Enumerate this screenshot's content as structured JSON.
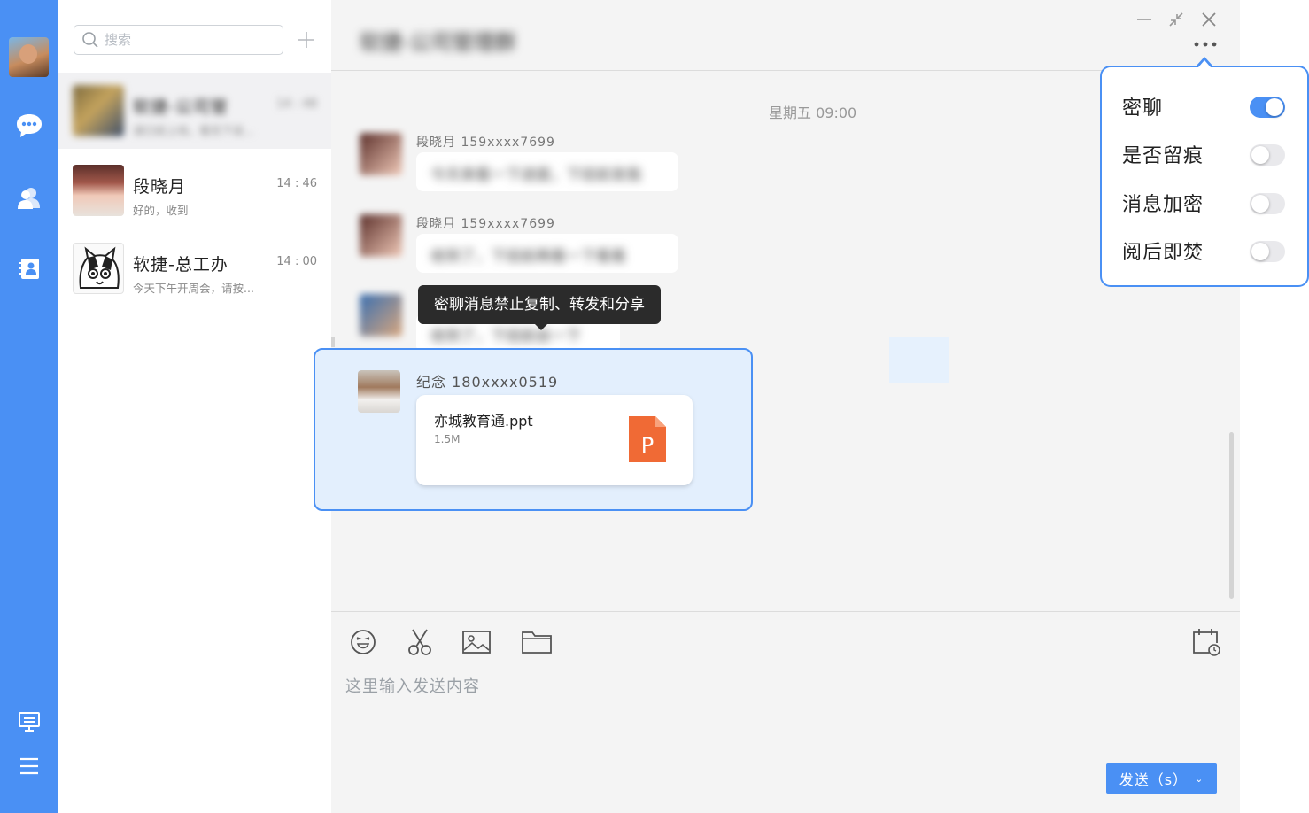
{
  "search": {
    "placeholder": "搜索"
  },
  "conversations": [
    {
      "name": "软捷-公司管",
      "time": "14 : 48",
      "preview": "请已经上线，看完下说...",
      "blurred": true
    },
    {
      "name": "段晓月",
      "time": "14 : 46",
      "preview": "好的，收到"
    },
    {
      "name": "软捷-总工办",
      "time": "14 : 00",
      "preview": "今天下午开周会，请按..."
    }
  ],
  "chat": {
    "title": "软捷-公司管理群",
    "date_stamp": "星期五 09:00",
    "messages": [
      {
        "sender": "段晓月 159xxxx7699",
        "text": "今天来看一下进度，下班前发我"
      },
      {
        "sender": "段晓月 159xxxx7699",
        "text": "收到了，下班前再看一下看看"
      },
      {
        "sender": "",
        "text": "收到了，下班前会一下"
      }
    ],
    "tooltip": "密聊消息禁止复制、转发和分享",
    "file_message": {
      "sender": "纪念  180xxxx0519",
      "file_name": "亦城教育通.ppt",
      "file_size": "1.5M",
      "file_icon_letter": "P"
    }
  },
  "composer": {
    "placeholder": "这里输入发送内容",
    "send_label": "发送（s）",
    "send_caret": "⌄"
  },
  "settings_menu": {
    "items": [
      {
        "label": "密聊",
        "enabled": true
      },
      {
        "label": "是否留痕",
        "enabled": false
      },
      {
        "label": "消息加密",
        "enabled": false
      },
      {
        "label": "阅后即焚",
        "enabled": false
      }
    ]
  },
  "colors": {
    "accent": "#4a90f4",
    "file_icon": "#f06a35",
    "tooltip_bg": "#2b2b2b"
  }
}
